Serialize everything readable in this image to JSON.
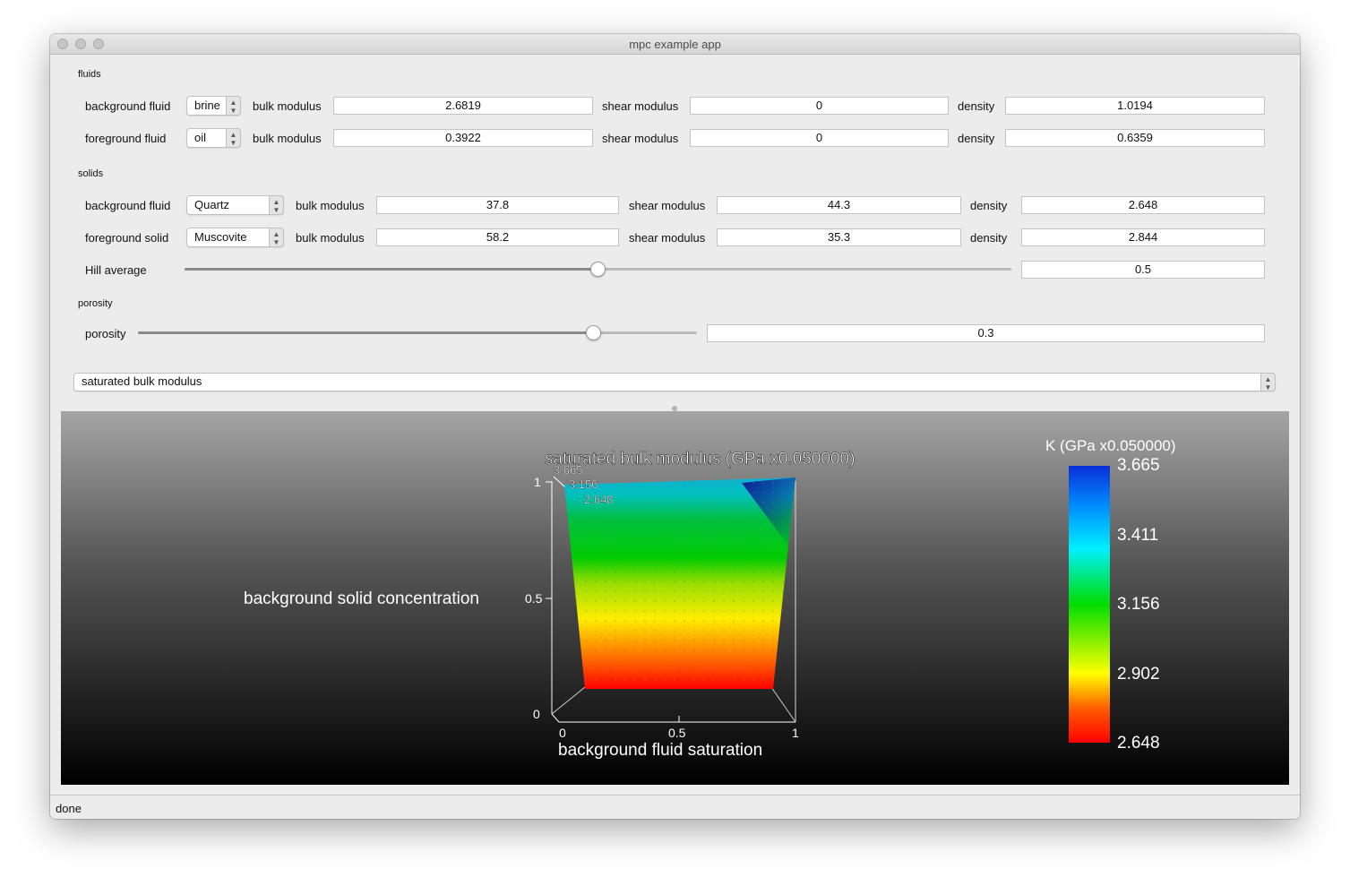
{
  "window": {
    "title": "mpc example app"
  },
  "fluids": {
    "section_label": "fluids",
    "rows": [
      {
        "label": "background fluid",
        "selected": "brine",
        "bulk_label": "bulk modulus",
        "bulk": "2.6819",
        "shear_label": "shear modulus",
        "shear": "0",
        "density_label": "density",
        "density": "1.0194"
      },
      {
        "label": "foreground fluid",
        "selected": "oil",
        "bulk_label": "bulk modulus",
        "bulk": "0.3922",
        "shear_label": "shear modulus",
        "shear": "0",
        "density_label": "density",
        "density": "0.6359"
      }
    ]
  },
  "solids": {
    "section_label": "solids",
    "rows": [
      {
        "label": "background fluid",
        "selected": "Quartz",
        "bulk_label": "bulk modulus",
        "bulk": "37.8",
        "shear_label": "shear modulus",
        "shear": "44.3",
        "density_label": "density",
        "density": "2.648"
      },
      {
        "label": "foreground solid",
        "selected": "Muscovite",
        "bulk_label": "bulk modulus",
        "bulk": "58.2",
        "shear_label": "shear modulus",
        "shear": "35.3",
        "density_label": "density",
        "density": "2.844"
      }
    ],
    "hill": {
      "label": "Hill average",
      "value": "0.5",
      "fraction": 0.5
    }
  },
  "porosity": {
    "section_label": "porosity",
    "label": "porosity",
    "value": "0.3",
    "fraction": 0.81
  },
  "property_select": {
    "selected": "saturated bulk modulus"
  },
  "plot": {
    "title": "saturated bulk modulus (GPa x0.050000)",
    "ylabel": "background solid concentration",
    "xlabel": "background fluid saturation",
    "yticks": [
      "1",
      "0.5",
      "0"
    ],
    "xticks": [
      "0",
      "0.5",
      "1"
    ],
    "z_ticks": [
      "3.665",
      "3.156",
      "2.648"
    ],
    "colorbar": {
      "title": "K (GPa x0.050000)",
      "ticks": [
        "3.665",
        "3.411",
        "3.156",
        "2.902",
        "2.648"
      ]
    },
    "colors": {
      "high": "#0b2fd8",
      "cyan": "#00f0ff",
      "green": "#00cc00",
      "yellow": "#ffff00",
      "low": "#ff0000"
    }
  },
  "status": {
    "text": "done"
  }
}
